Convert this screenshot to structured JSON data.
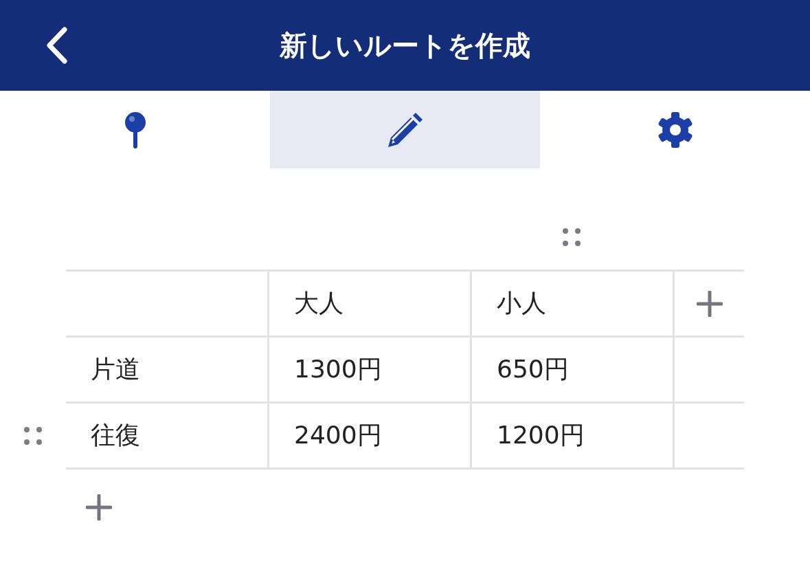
{
  "header": {
    "title": "新しいルートを作成"
  },
  "tabs": [
    {
      "kind": "pin",
      "selected": false
    },
    {
      "kind": "pencil",
      "selected": true
    },
    {
      "kind": "gear",
      "selected": false
    }
  ],
  "table": {
    "columns": [
      {
        "label": "大人",
        "drag_handle": false
      },
      {
        "label": "小人",
        "drag_handle": true
      }
    ],
    "rows": [
      {
        "label": "片道",
        "cells": [
          "1300円",
          "650円"
        ],
        "drag_handle": false
      },
      {
        "label": "往復",
        "cells": [
          "2400円",
          "1200円"
        ],
        "drag_handle": true
      }
    ]
  }
}
